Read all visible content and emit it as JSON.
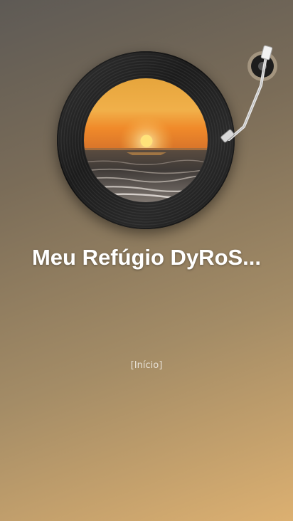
{
  "station": {
    "title": "Meu Refúgio DyRoS..."
  },
  "navigation": {
    "home_link": "[Início]"
  },
  "artwork": {
    "subject": "sunset over the sea"
  },
  "colors": {
    "background_top": "#5e5a55",
    "background_bottom": "#dcb071",
    "title_text": "#ffffff",
    "link_text": "#e8e2d8",
    "vinyl": "#1c1c1c"
  },
  "icons": [
    "vinyl-record-icon",
    "tonearm-icon"
  ]
}
